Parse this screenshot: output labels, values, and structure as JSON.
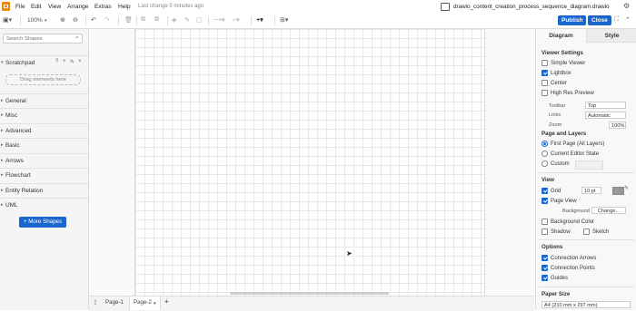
{
  "menubar": {
    "items": [
      "File",
      "Edit",
      "View",
      "Arrange",
      "Extras",
      "Help"
    ],
    "last_change": "Last change 5 minutes ago",
    "filename": "drawio_content_creation_process_sequence_diagram.drawio"
  },
  "toolbar": {
    "zoom": "100%",
    "publish": "Publish",
    "close": "Close"
  },
  "sidebar": {
    "search_placeholder": "Search Shapes",
    "scratchpad": "Scratchpad",
    "drag_hint": "Drag elements here",
    "sections": [
      "General",
      "Misc",
      "Advanced",
      "Basic",
      "Arrows",
      "Flowchart",
      "Entity Relation",
      "UML"
    ],
    "more_shapes": "+ More Shapes"
  },
  "pages": [
    "Page-1",
    "Page-2"
  ],
  "panel": {
    "tabs": [
      "Diagram",
      "Style"
    ],
    "viewer_settings": "Viewer Settings",
    "simple_viewer": "Simple Viewer",
    "lightbox": "Lightbox",
    "center": "Center",
    "high_res": "High Res Preview",
    "toolbar_label": "Toolbar",
    "toolbar_value": "Top",
    "links_label": "Links",
    "links_value": "Automatic",
    "zoom_label": "Zoom",
    "zoom_value": "100%",
    "page_layers": "Page and Layers",
    "first_page": "First Page (All Layers)",
    "current_state": "Current Editor State",
    "custom": "Custom",
    "view": "View",
    "grid": "Grid",
    "grid_value": "10 pt",
    "page_view": "Page View",
    "background": "Background",
    "change": "Change...",
    "bg_color": "Background Color",
    "shadow": "Shadow",
    "sketch": "Sketch",
    "options": "Options",
    "conn_arrows": "Connection Arrows",
    "conn_points": "Connection Points",
    "guides": "Guides",
    "paper_size": "Paper Size",
    "paper_value": "A4 (210 mm x 297 mm)"
  }
}
